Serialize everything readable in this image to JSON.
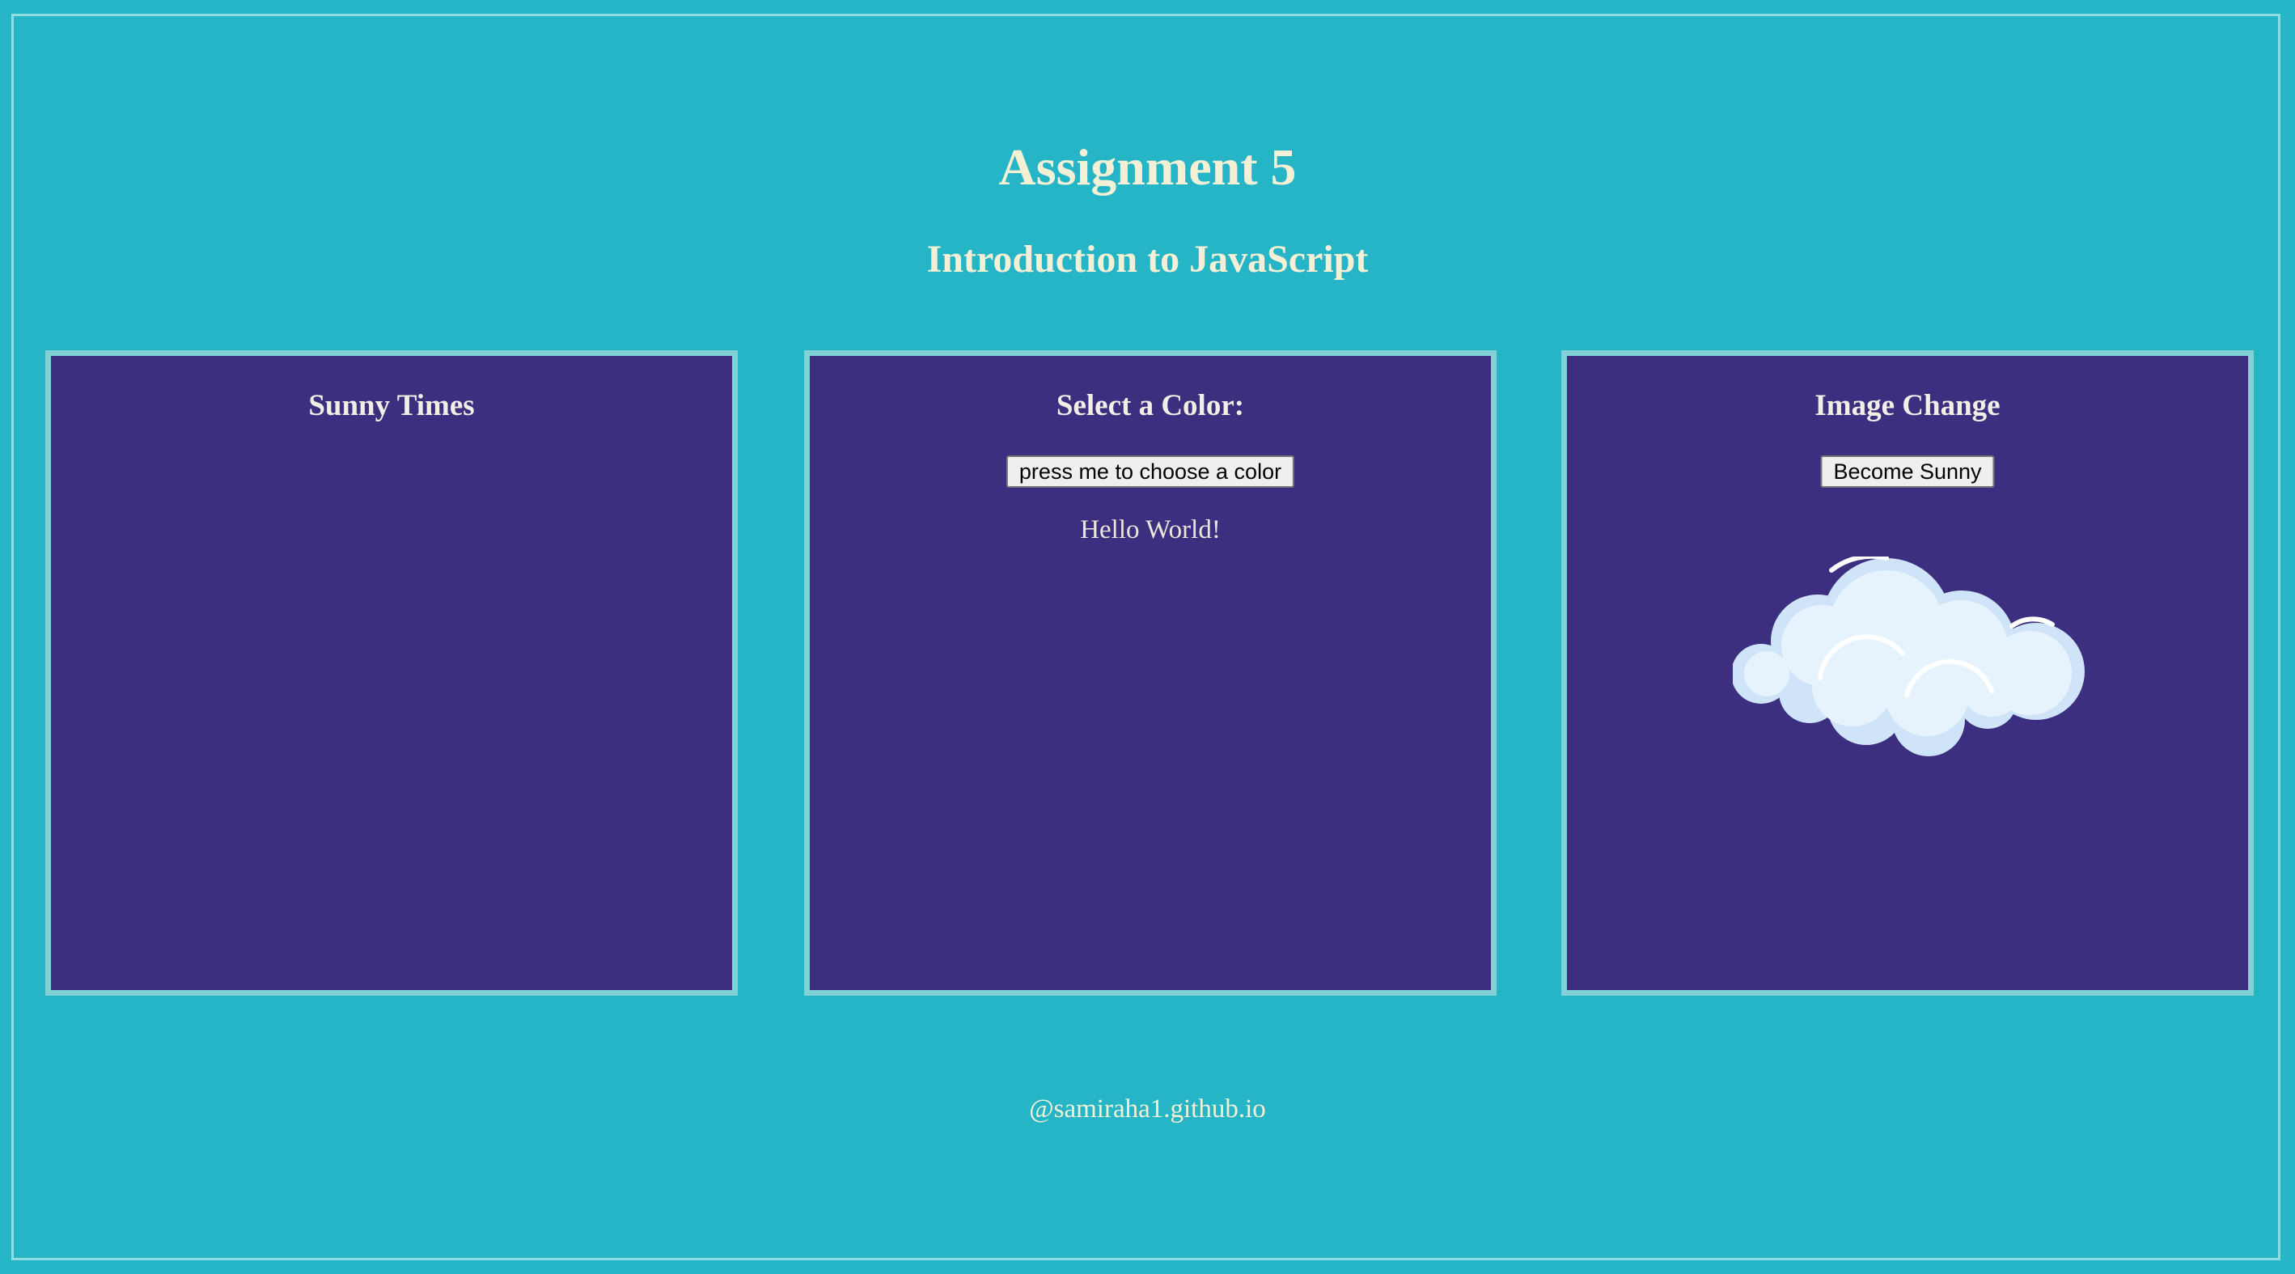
{
  "header": {
    "title": "Assignment 5",
    "subtitle": "Introduction to JavaScript"
  },
  "panels": [
    {
      "title": "Sunny Times"
    },
    {
      "title": "Select a Color:",
      "button_label": "press me to choose a color",
      "message": "Hello World!"
    },
    {
      "title": "Image Change",
      "button_label": "Become Sunny",
      "image": "cloud"
    }
  ],
  "footer": {
    "text": "@samiraha1.github.io"
  },
  "colors": {
    "background": "#26b5c6",
    "panel": "#3c2f7f",
    "panel_border": "#7fd3d6",
    "heading_text": "#f3f0d6"
  }
}
